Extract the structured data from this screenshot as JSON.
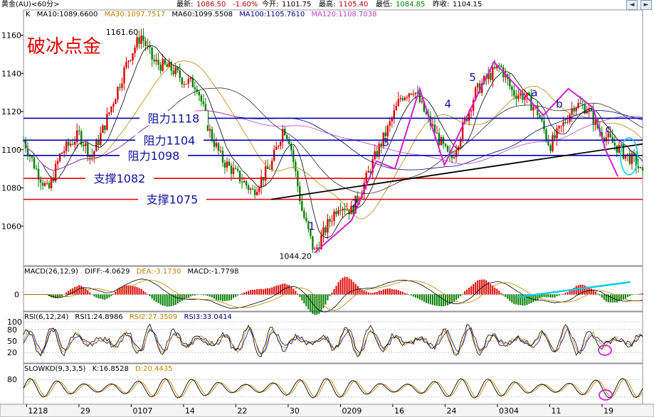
{
  "header": {
    "symbol": "黄金(AU)<60分>",
    "latest_label": "最新:",
    "latest_value": "1086.50",
    "change_pct": "-1.60%",
    "open_label": "今开:",
    "open_value": "1101.75",
    "high_label": "最高:",
    "high_value": "1105.40",
    "low_label": "最低:",
    "low_value": "1084.85",
    "prev_close_label": "昨收:",
    "prev_close_value": "1104.15"
  },
  "window_buttons": [
    "◄",
    "►"
  ],
  "ma_legend": {
    "prefix": "K",
    "items": [
      {
        "text": "MA10:1089.6600",
        "color": "#000000"
      },
      {
        "text": "MA30:1097.7517",
        "color": "#c08000"
      },
      {
        "text": "MA60:1099.5508",
        "color": "#000000"
      },
      {
        "text": "MA100:1105.7610",
        "color": "#000080"
      },
      {
        "text": "MA120:1108.7038",
        "color": "#c040c0"
      }
    ]
  },
  "macd_legend": [
    {
      "text": "MACD(26,12,9)",
      "color": "#000000"
    },
    {
      "text": "DIFF:-4.0629",
      "color": "#000000"
    },
    {
      "text": "DEA:-3.1730",
      "color": "#c08000"
    },
    {
      "text": "MACD:-1.7798",
      "color": "#000000"
    }
  ],
  "rsi_legend": [
    {
      "text": "RSI(6,12,24)",
      "color": "#000000"
    },
    {
      "text": "RSI1:24.8986",
      "color": "#000000"
    },
    {
      "text": "RSI2:27.3509",
      "color": "#c08000"
    },
    {
      "text": "RSI3:33.0414",
      "color": "#000080"
    }
  ],
  "kd_legend": [
    {
      "text": "SLOWKD(9,3,3,5)",
      "color": "#000000"
    },
    {
      "text": "K:16.8528",
      "color": "#000000"
    },
    {
      "text": "D:20.4435",
      "color": "#c08000"
    }
  ],
  "colors": {
    "resistance": "#0000b0",
    "support": "#e00000",
    "trend": "#000000",
    "wave": "#d020d0",
    "up": "#e00000",
    "down": "#008000",
    "highlight": "#00d0e0"
  },
  "chart_data": {
    "type": "candlestick",
    "title": "破冰点金",
    "x_ticks": [
      "1218",
      "29",
      "0107",
      "14",
      "22",
      "30",
      "0209",
      "16",
      "24",
      "0304",
      "11",
      "19"
    ],
    "y_ticks": [
      1160,
      1140,
      1120,
      1100,
      1080,
      1060
    ],
    "ylim": [
      1040,
      1168
    ],
    "price_path": [
      [
        0,
        1105
      ],
      [
        0.02,
        1090
      ],
      [
        0.04,
        1078
      ],
      [
        0.06,
        1098
      ],
      [
        0.09,
        1108
      ],
      [
        0.11,
        1096
      ],
      [
        0.13,
        1112
      ],
      [
        0.15,
        1130
      ],
      [
        0.17,
        1148
      ],
      [
        0.19,
        1160
      ],
      [
        0.21,
        1146
      ],
      [
        0.24,
        1142
      ],
      [
        0.26,
        1136
      ],
      [
        0.28,
        1134
      ],
      [
        0.3,
        1110
      ],
      [
        0.32,
        1095
      ],
      [
        0.35,
        1085
      ],
      [
        0.37,
        1078
      ],
      [
        0.4,
        1092
      ],
      [
        0.42,
        1112
      ],
      [
        0.43,
        1105
      ],
      [
        0.45,
        1068
      ],
      [
        0.47,
        1046
      ],
      [
        0.49,
        1060
      ],
      [
        0.51,
        1072
      ],
      [
        0.53,
        1068
      ],
      [
        0.55,
        1082
      ],
      [
        0.57,
        1098
      ],
      [
        0.59,
        1112
      ],
      [
        0.61,
        1128
      ],
      [
        0.63,
        1132
      ],
      [
        0.65,
        1118
      ],
      [
        0.67,
        1106
      ],
      [
        0.69,
        1094
      ],
      [
        0.71,
        1112
      ],
      [
        0.73,
        1130
      ],
      [
        0.75,
        1138
      ],
      [
        0.77,
        1144
      ],
      [
        0.79,
        1130
      ],
      [
        0.81,
        1128
      ],
      [
        0.83,
        1120
      ],
      [
        0.85,
        1102
      ],
      [
        0.87,
        1112
      ],
      [
        0.89,
        1124
      ],
      [
        0.91,
        1122
      ],
      [
        0.93,
        1110
      ],
      [
        0.95,
        1104
      ],
      [
        0.97,
        1098
      ],
      [
        0.99,
        1093
      ],
      [
        1.0,
        1086
      ]
    ],
    "price_labels": [
      {
        "text": "1161.60",
        "x": 0.19,
        "y": 1161.6
      },
      {
        "text": "1044.20",
        "x": 0.47,
        "y": 1044.2
      }
    ],
    "resistance": [
      {
        "label": "阻力1118",
        "value": 1116.5
      },
      {
        "label": "阻力1104",
        "value": 1105
      },
      {
        "label": "阻力1098",
        "value": 1097
      }
    ],
    "support": [
      {
        "label": "支撑1082",
        "value": 1085
      },
      {
        "label": "支撑1075",
        "value": 1074
      }
    ],
    "trendline": [
      [
        0.4,
        1074
      ],
      [
        1.0,
        1103
      ]
    ],
    "waves": [
      {
        "label": "1",
        "x": 0.46,
        "y": 1058
      },
      {
        "label": "2",
        "x": 0.53,
        "y": 1070
      },
      {
        "label": "3",
        "x": 0.58,
        "y": 1102
      },
      {
        "label": "4",
        "x": 0.68,
        "y": 1122
      },
      {
        "label": "5",
        "x": 0.72,
        "y": 1136
      },
      {
        "label": "a",
        "x": 0.82,
        "y": 1128
      },
      {
        "label": "b",
        "x": 0.86,
        "y": 1122
      },
      {
        "label": "c",
        "x": 0.94,
        "y": 1109
      }
    ],
    "wave_path": [
      [
        0.47,
        1046
      ],
      [
        0.53,
        1063
      ],
      [
        0.57,
        1094
      ],
      [
        0.6,
        1090
      ],
      [
        0.64,
        1132
      ],
      [
        0.68,
        1092
      ],
      [
        0.72,
        1120
      ],
      [
        0.76,
        1146
      ],
      [
        0.8,
        1132
      ],
      [
        0.84,
        1118
      ],
      [
        0.88,
        1132
      ],
      [
        0.92,
        1122
      ],
      [
        0.94,
        1100
      ],
      [
        0.96,
        1086
      ]
    ],
    "macd_zero_label": "0",
    "rsi_ticks": [
      100,
      80,
      50,
      20
    ],
    "kd_ticks": [
      80,
      20
    ]
  }
}
